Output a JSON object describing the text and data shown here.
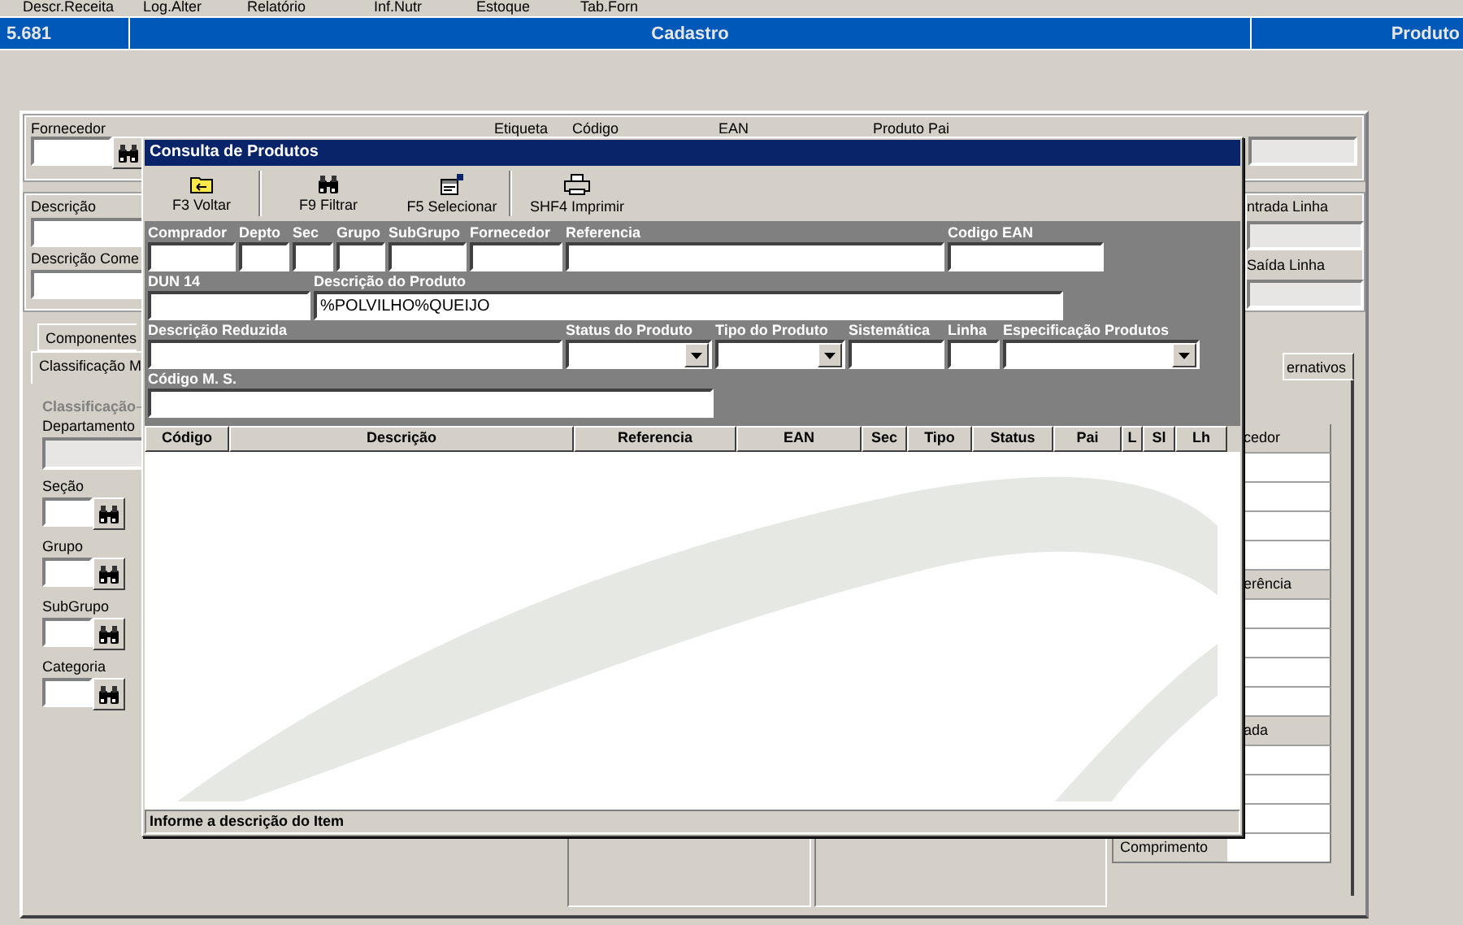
{
  "menu": [
    "Descr.Receita",
    "Log.Alter",
    "Relatório",
    "Inf.Nutr",
    "Estoque",
    "Tab.Forn"
  ],
  "header_bar": {
    "code": "5.681",
    "title": "Cadastro",
    "section": "Produto"
  },
  "form": {
    "fornecedor_label": "Fornecedor",
    "top_labels": [
      "Etiqueta",
      "Código",
      "EAN",
      "Produto Pai"
    ],
    "descricao_label": "Descrição",
    "descricao_comercial_label": "Descrição Come",
    "entrada_label": "ntrada Linha",
    "saida_label": "Saída Linha"
  },
  "tabs": [
    {
      "label": "Componentes",
      "selected": false
    },
    {
      "label": "Classificação M",
      "selected": true
    }
  ],
  "right_tab": {
    "label": "ernativos"
  },
  "classification": {
    "group_label": "Classificação",
    "departamento_label": "Departamento",
    "lookups": [
      "Seção",
      "Grupo",
      "SubGrupo",
      "Categoria"
    ]
  },
  "side_table": [
    {
      "kind": "header",
      "label": "cedor"
    },
    {
      "kind": "row"
    },
    {
      "kind": "row"
    },
    {
      "kind": "row"
    },
    {
      "kind": "row"
    },
    {
      "kind": "header",
      "label": "erência"
    },
    {
      "kind": "row"
    },
    {
      "kind": "row"
    },
    {
      "kind": "row"
    },
    {
      "kind": "row"
    },
    {
      "kind": "header",
      "label": "ada"
    },
    {
      "kind": "row"
    },
    {
      "kind": "row"
    },
    {
      "kind": "row"
    },
    {
      "kind": "labeled",
      "label": "Comprimento"
    }
  ],
  "dialog": {
    "title": "Consulta de Produtos",
    "toolbar": [
      {
        "kind": "back",
        "label": "F3 Voltar"
      },
      {
        "kind": "filter",
        "label": "F9 Filtrar"
      },
      {
        "kind": "select",
        "label": "F5 Selecionar"
      },
      {
        "kind": "print",
        "label": "SHF4 Imprimir"
      }
    ],
    "filter_rows": [
      [
        {
          "label": "Comprador",
          "kind": "text"
        },
        {
          "label": "Depto",
          "kind": "text"
        },
        {
          "label": "Sec",
          "kind": "text"
        },
        {
          "label": "Grupo",
          "kind": "text"
        },
        {
          "label": "SubGrupo",
          "kind": "text"
        },
        {
          "label": "Fornecedor",
          "kind": "text"
        },
        {
          "label": "Referencia",
          "kind": "text"
        },
        {
          "label": "Codigo EAN",
          "kind": "text"
        }
      ],
      [
        {
          "label": "DUN 14",
          "kind": "text"
        },
        {
          "label": "Descrição do Produto",
          "kind": "text",
          "value": "%POLVILHO%QUEIJO"
        }
      ],
      [
        {
          "label": "Descrição Reduzida",
          "kind": "text"
        },
        {
          "label": "Status do Produto",
          "kind": "select"
        },
        {
          "label": "Tipo do Produto",
          "kind": "select"
        },
        {
          "label": "Sistemática",
          "kind": "text"
        },
        {
          "label": "Linha",
          "kind": "text"
        },
        {
          "label": "Especificação Produtos",
          "kind": "select"
        }
      ],
      [
        {
          "label": "Código M. S.",
          "kind": "text"
        }
      ]
    ],
    "columns": [
      "Código",
      "Descrição",
      "Referencia",
      "EAN",
      "Sec",
      "Tipo",
      "Status",
      "Pai",
      "L",
      "Sl",
      "Lh"
    ],
    "status": "Informe a descrição do Item"
  }
}
